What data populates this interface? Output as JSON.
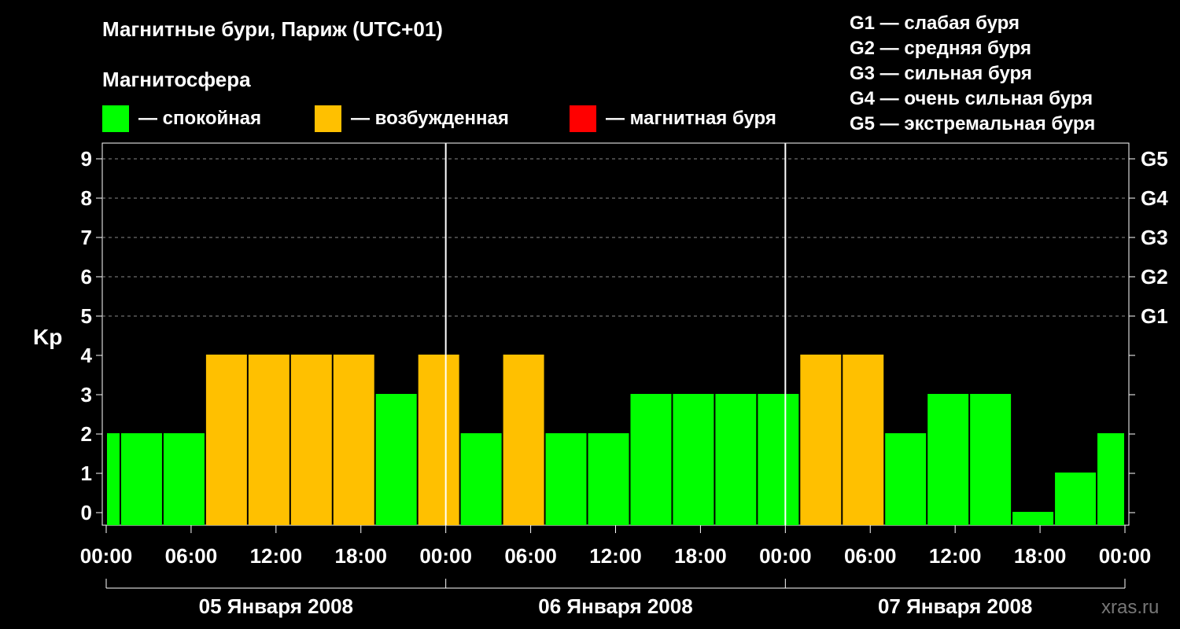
{
  "title": "Магнитные бури, Париж (UTC+01)",
  "subtitle": "Магнитосфера",
  "legend": [
    {
      "color": "#00ff00",
      "label": "— спокойная"
    },
    {
      "color": "#ffc000",
      "label": "— возбужденная"
    },
    {
      "color": "#ff0000",
      "label": "— магнитная буря"
    }
  ],
  "g_legend": [
    "G1 — слабая буря",
    "G2 — средняя буря",
    "G3 — сильная буря",
    "G4 — очень сильная буря",
    "G5 — экстремальная буря"
  ],
  "watermark": "xras.ru",
  "chart_data": {
    "type": "bar",
    "ylabel": "Kp",
    "ylim": [
      0,
      9
    ],
    "y_ticks": [
      "0",
      "1",
      "2",
      "3",
      "4",
      "5",
      "6",
      "7",
      "8",
      "9"
    ],
    "g_ticks": [
      {
        "value": 5,
        "label": "G1"
      },
      {
        "value": 6,
        "label": "G2"
      },
      {
        "value": 7,
        "label": "G3"
      },
      {
        "value": 8,
        "label": "G4"
      },
      {
        "value": 9,
        "label": "G5"
      }
    ],
    "x_tick_labels": [
      "00:00",
      "06:00",
      "12:00",
      "18:00",
      "00:00",
      "06:00",
      "12:00",
      "18:00",
      "00:00",
      "06:00",
      "12:00",
      "18:00",
      "00:00"
    ],
    "days": [
      "05 Января 2008",
      "06 Января 2008",
      "07 Января 2008"
    ],
    "grid": "dashed horizontal at 5–9",
    "colors": {
      "quiet": "#00ff00",
      "active": "#ffc000",
      "storm": "#ff0000"
    },
    "bars": [
      {
        "start_hour": 0,
        "end_hour": 1,
        "value": 2
      },
      {
        "start_hour": 1,
        "end_hour": 4,
        "value": 2
      },
      {
        "start_hour": 4,
        "end_hour": 7,
        "value": 2
      },
      {
        "start_hour": 7,
        "end_hour": 10,
        "value": 4
      },
      {
        "start_hour": 10,
        "end_hour": 13,
        "value": 4
      },
      {
        "start_hour": 13,
        "end_hour": 16,
        "value": 4
      },
      {
        "start_hour": 16,
        "end_hour": 19,
        "value": 4
      },
      {
        "start_hour": 19,
        "end_hour": 22,
        "value": 3
      },
      {
        "start_hour": 22,
        "end_hour": 25,
        "value": 4
      },
      {
        "start_hour": 25,
        "end_hour": 28,
        "value": 2
      },
      {
        "start_hour": 28,
        "end_hour": 31,
        "value": 4
      },
      {
        "start_hour": 31,
        "end_hour": 34,
        "value": 2
      },
      {
        "start_hour": 34,
        "end_hour": 37,
        "value": 2
      },
      {
        "start_hour": 37,
        "end_hour": 40,
        "value": 3
      },
      {
        "start_hour": 40,
        "end_hour": 43,
        "value": 3
      },
      {
        "start_hour": 43,
        "end_hour": 46,
        "value": 3
      },
      {
        "start_hour": 46,
        "end_hour": 49,
        "value": 3
      },
      {
        "start_hour": 49,
        "end_hour": 52,
        "value": 4
      },
      {
        "start_hour": 52,
        "end_hour": 55,
        "value": 4
      },
      {
        "start_hour": 55,
        "end_hour": 58,
        "value": 2
      },
      {
        "start_hour": 58,
        "end_hour": 61,
        "value": 3
      },
      {
        "start_hour": 61,
        "end_hour": 64,
        "value": 3
      },
      {
        "start_hour": 64,
        "end_hour": 67,
        "value": 0
      },
      {
        "start_hour": 67,
        "end_hour": 70,
        "value": 1
      },
      {
        "start_hour": 70,
        "end_hour": 72,
        "value": 2
      }
    ]
  }
}
